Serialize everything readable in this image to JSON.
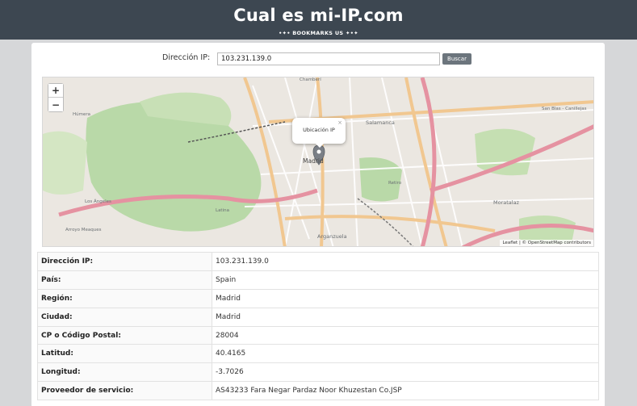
{
  "header": {
    "title": "Cual es mi-IP.com",
    "subtitle": "•✦• BOOKMARKS US ✦•✦"
  },
  "search": {
    "label": "Dirección IP:",
    "value": "103.231.139.0",
    "button": "Buscar"
  },
  "map": {
    "zoom_in": "+",
    "zoom_out": "−",
    "popup": "Ubicación IP",
    "popup_close": "×",
    "attribution": "Leaflet | © OpenStreetMap contributors",
    "labels": {
      "madrid": "Madrid",
      "salamanca": "Salamanca",
      "chamberi": "Chamberí",
      "retiro": "Retiro",
      "moratalaz": "Moratalaz",
      "arganzuela": "Arganzuela",
      "latina": "Latina",
      "humera": "Húmera",
      "los_angeles": "Los Ángeles",
      "arroyo": "Arroyo Meaques",
      "sanblas": "San Blas - Canillejas"
    }
  },
  "details": [
    {
      "label": "Dirección IP:",
      "value": "103.231.139.0"
    },
    {
      "label": "País:",
      "value": "Spain"
    },
    {
      "label": "Región:",
      "value": "Madrid"
    },
    {
      "label": "Ciudad:",
      "value": "Madrid"
    },
    {
      "label": "CP o Código Postal:",
      "value": "28004"
    },
    {
      "label": "Latitud:",
      "value": "40.4165"
    },
    {
      "label": "Longitud:",
      "value": "-3.7026"
    },
    {
      "label": "Proveedor de servicio:",
      "value": "AS43233 Fara Negar Pardaz Noor Khuzestan Co.JSP"
    }
  ]
}
